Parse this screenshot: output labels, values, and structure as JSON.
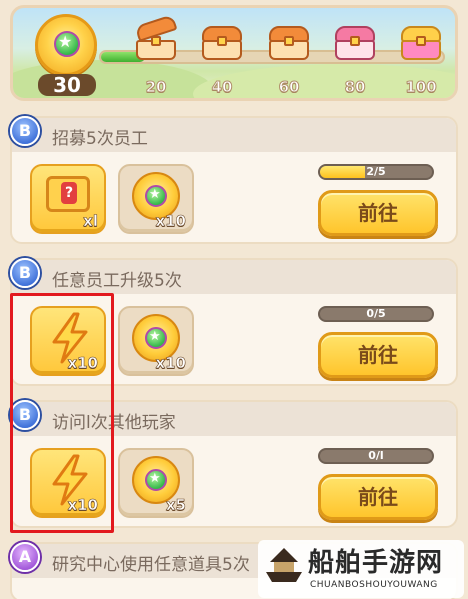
{
  "banner": {
    "level": "30",
    "progress_fraction": 0.13,
    "milestones": [
      "20",
      "40",
      "60",
      "80",
      "100"
    ]
  },
  "tasks": [
    {
      "grade": "B",
      "title": "招募5次员工",
      "rewards": [
        {
          "icon": "ticket-icon",
          "qty": "xl"
        },
        {
          "icon": "medal-coin-icon",
          "qty": "x10"
        }
      ],
      "progress_text": "2/5",
      "progress_fraction": 0.4,
      "button": "前往"
    },
    {
      "grade": "B",
      "title": "任意员工升级5次",
      "rewards": [
        {
          "icon": "lightning-icon",
          "qty": "x10"
        },
        {
          "icon": "medal-coin-icon",
          "qty": "x10"
        }
      ],
      "progress_text": "0/5",
      "progress_fraction": 0,
      "button": "前往"
    },
    {
      "grade": "B",
      "title": "访问l次其他玩家",
      "rewards": [
        {
          "icon": "lightning-icon",
          "qty": "x10"
        },
        {
          "icon": "medal-coin-icon",
          "qty": "x5"
        }
      ],
      "progress_text": "0/l",
      "progress_fraction": 0,
      "button": "前往"
    },
    {
      "grade": "A",
      "title": "研究中心使用任意道具5次"
    }
  ],
  "watermark": {
    "title": "船舶手游网",
    "subtitle": "CHUANBOSHOUYOUWANG"
  },
  "colors": {
    "background": "#f3e7d4",
    "button": "#ffc52c",
    "highlight": "#e2191e",
    "grade_b": "#3d6fd8",
    "grade_a": "#a055d8"
  }
}
